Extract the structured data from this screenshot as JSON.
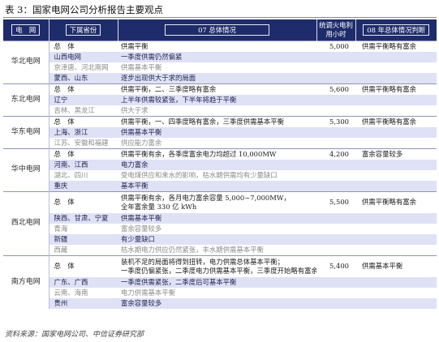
{
  "caption": "表 3：国家电网公司分析报告主要观点",
  "headers": {
    "region": "电　网",
    "province": "下属省份",
    "situation": "07 总体情况",
    "capacity": "统调火电利用小时",
    "judgment": "08 年总体情况判断"
  },
  "groups": [
    {
      "region": "华北电网",
      "rows": [
        {
          "style": "plain",
          "province": "总　体",
          "situation": [
            "供需平衡"
          ],
          "capacity": "5,000",
          "judgment": "供需平衡略有富余"
        },
        {
          "style": "blue",
          "province": "山西电网",
          "situation": [
            "一季度供需仍然偏紧"
          ],
          "capacity": "",
          "judgment": ""
        },
        {
          "style": "gray",
          "province": "京津唐、河北南网",
          "situation": [
            "供需基本平衡"
          ],
          "capacity": "",
          "judgment": ""
        },
        {
          "style": "blue",
          "province": "蒙西、山东",
          "situation": [
            "逐步出现供大于求的局面"
          ],
          "capacity": "",
          "judgment": ""
        }
      ]
    },
    {
      "region": "东北电网",
      "rows": [
        {
          "style": "plain",
          "province": "总　体",
          "situation": [
            "供需平衡，二、三季度略有富余"
          ],
          "capacity": "5,600",
          "judgment": "供需平衡略有富余"
        },
        {
          "style": "blue",
          "province": "辽宁",
          "situation": [
            "上半年供需较紧张，下半年将趋于平衡"
          ],
          "capacity": "",
          "judgment": ""
        },
        {
          "style": "gray",
          "province": "吉林、黑龙江",
          "situation": [
            "供大于求"
          ],
          "capacity": "",
          "judgment": ""
        }
      ]
    },
    {
      "region": "华东电网",
      "rows": [
        {
          "style": "plain",
          "province": "总　体",
          "situation": [
            "供需平衡，一、四季度略有富余，三季度供需基本平衡"
          ],
          "capacity": "5,300",
          "judgment": "供需平衡略有富余"
        },
        {
          "style": "blue",
          "province": "上海、浙江",
          "situation": [
            "供需基本平衡"
          ],
          "capacity": "",
          "judgment": ""
        },
        {
          "style": "gray",
          "province": "江苏、安徽和福建",
          "situation": [
            "供应能力富余"
          ],
          "capacity": "",
          "judgment": ""
        }
      ]
    },
    {
      "region": "华中电网",
      "rows": [
        {
          "style": "plain",
          "province": "总　体",
          "situation": [
            "供需平衡有余，各季度富余电力均超过 10,000MW"
          ],
          "capacity": "4,200",
          "judgment": "富余容量较多"
        },
        {
          "style": "blue",
          "province": "河南、江西",
          "situation": [
            "电力富余"
          ],
          "capacity": "",
          "judgment": ""
        },
        {
          "style": "gray",
          "province": "湖北、四川",
          "situation": [
            "受电煤供应和来水的影响，枯水期供需均有少量缺口"
          ],
          "capacity": "",
          "judgment": ""
        },
        {
          "style": "blue",
          "province": "重庆",
          "situation": [
            "基本平衡"
          ],
          "capacity": "",
          "judgment": ""
        }
      ]
    },
    {
      "region": "西北电网",
      "rows": [
        {
          "style": "plain",
          "tall": true,
          "province": "总　体",
          "situation": [
            "供需平衡有余，各月电力富余容量 5,000~7,000MW，",
            "全年富余量 330 亿 kWh"
          ],
          "capacity": "5,500",
          "judgment": "供需平衡略有富余"
        },
        {
          "style": "blue",
          "province": "陕西、甘肃、宁夏",
          "situation": [
            "供需基本平衡"
          ],
          "capacity": "",
          "judgment": ""
        },
        {
          "style": "gray",
          "province": "青海",
          "situation": [
            "富余容量较多"
          ],
          "capacity": "",
          "judgment": ""
        },
        {
          "style": "blue",
          "province": "新疆",
          "situation": [
            "有少量缺口"
          ],
          "capacity": "",
          "judgment": ""
        },
        {
          "style": "gray",
          "province": "西藏",
          "situation": [
            "枯水期电力供应仍然紧张，丰水期供需基本平衡"
          ],
          "capacity": "",
          "judgment": ""
        }
      ]
    },
    {
      "region": "南方电网",
      "rows": [
        {
          "style": "plain",
          "tall": true,
          "province": "总　体",
          "situation": [
            "装机不足的局面将得到扭转，电力供需总体基本平衡；",
            "一季度仍偏紧张，二季度电力供需基本平衡，三季度开始略有富余"
          ],
          "capacity": "5,400",
          "judgment": "供需基本平衡"
        },
        {
          "style": "blue",
          "province": "广东、广西",
          "situation": [
            "一季度供需紧张，二季度后可基本平衡"
          ],
          "capacity": "",
          "judgment": ""
        },
        {
          "style": "gray",
          "province": "云南、海南",
          "situation": [
            "电力供需基本平衡"
          ],
          "capacity": "",
          "judgment": ""
        },
        {
          "style": "blue",
          "province": "贵州",
          "situation": [
            "富余容量较多"
          ],
          "capacity": "",
          "judgment": ""
        }
      ]
    }
  ],
  "source": "资料来源：国家电网公司、中信证券研究部"
}
